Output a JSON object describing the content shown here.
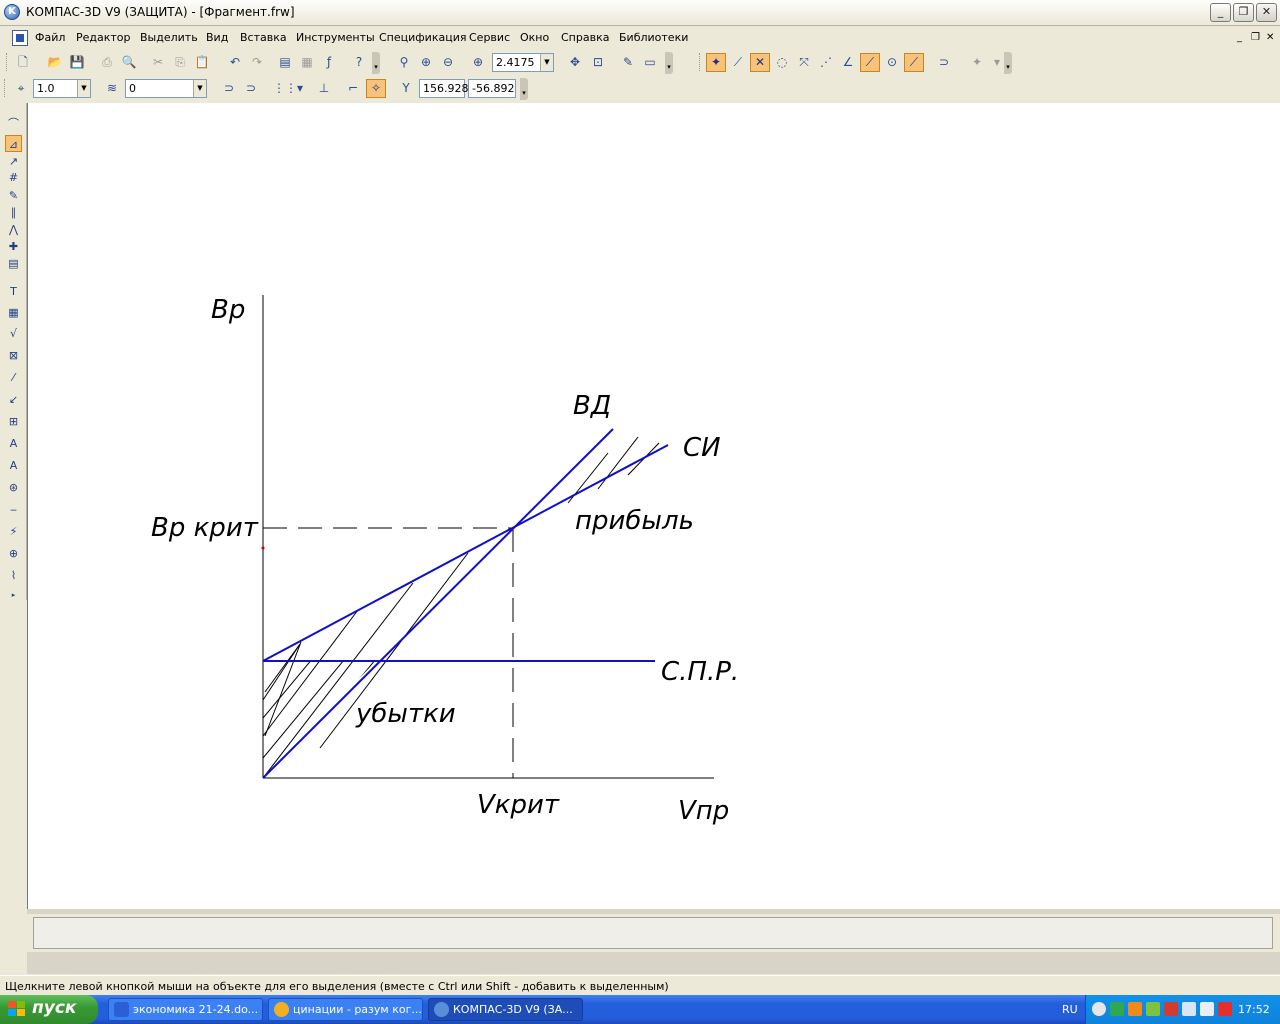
{
  "window": {
    "title": "КОМПАС-3D V9 (ЗАЩИТА) - [Фрагмент.frw]",
    "minimize": "_",
    "maximize": "❐",
    "close": "✕"
  },
  "menu": {
    "items": [
      "Файл",
      "Редактор",
      "Выделить",
      "Вид",
      "Вставка",
      "Инструменты",
      "Спецификация",
      "Сервис",
      "Окно",
      "Справка",
      "Библиотеки"
    ],
    "mdi_minimize": "_",
    "mdi_restore": "❐",
    "mdi_close": "✕"
  },
  "toolbar_main": {
    "zoom_value": "2.4175"
  },
  "toolbar_props": {
    "scale_value": "1.0",
    "layer_value": "0",
    "coord_x": "156.928",
    "coord_y": "-56.892"
  },
  "drawing": {
    "label_vr": "Вр",
    "label_vd": "ВД",
    "label_si": "СИ",
    "label_vr_krit": "Вр крит",
    "label_pribyl": "прибыль",
    "label_spr": "С.П.Р.",
    "label_ubytki": "убытки",
    "label_vkrit": "Vкрит",
    "label_vpr": "Vпр",
    "line_color": "#1010c8"
  },
  "status": {
    "hint": "Щелкните левой кнопкой мыши на объекте для его выделения (вместе с Ctrl или Shift - добавить к выделенным)"
  },
  "taskbar": {
    "start_label": "пуск",
    "tasks": [
      {
        "label": "экономика 21-24.do...",
        "icon_color": "#2b5fd6"
      },
      {
        "label": "цинации - разум ког...",
        "icon_color": "#f0b020"
      },
      {
        "label": "КОМПАС-3D V9 (ЗА...",
        "icon_color": "#5a8fd8"
      }
    ],
    "lang": "RU",
    "clock": "17:52"
  }
}
